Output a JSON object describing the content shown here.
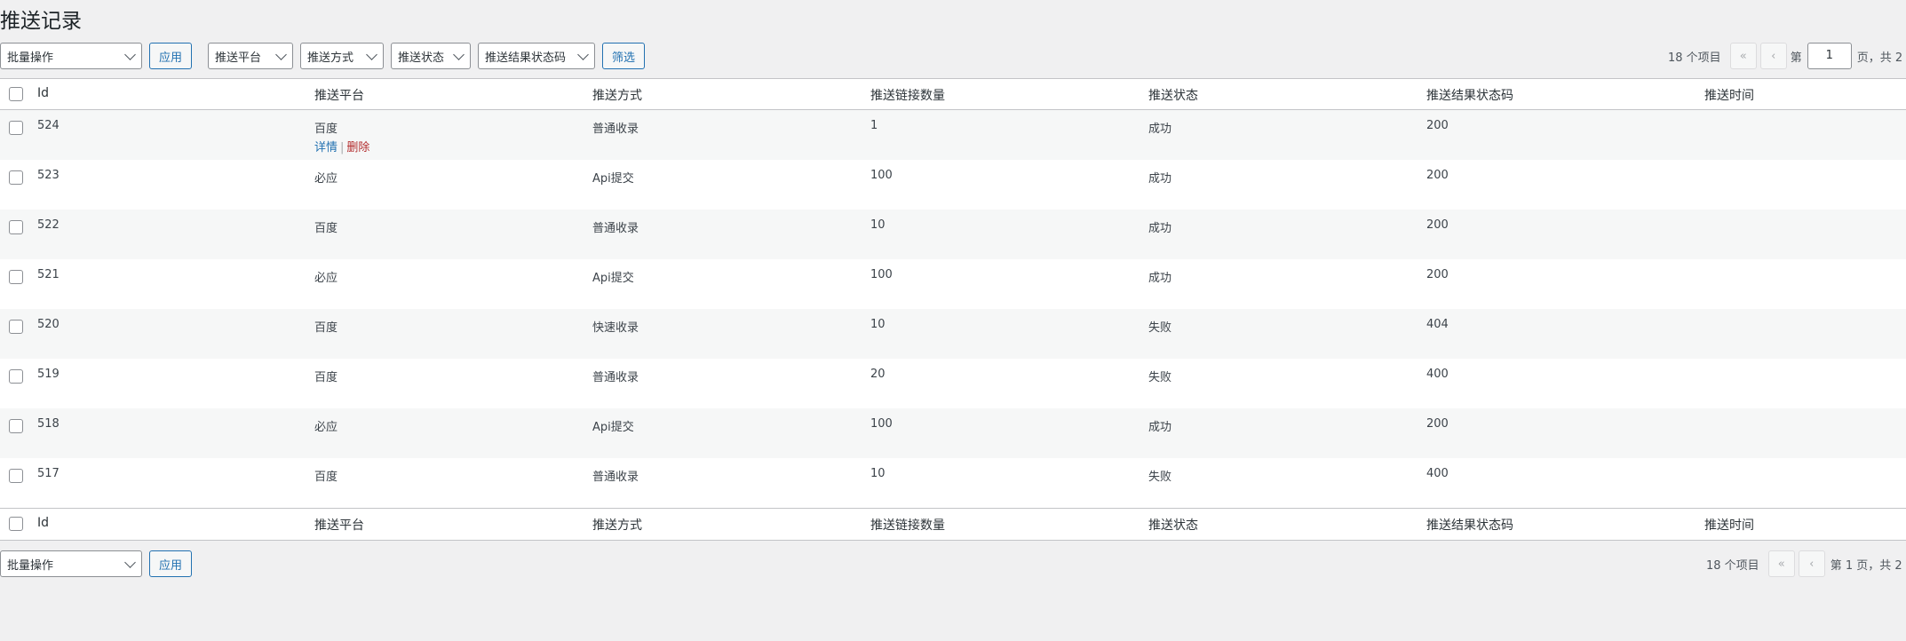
{
  "page_title": "推送记录",
  "top_bar": {
    "bulk_action": "批量操作",
    "apply": "应用",
    "filter_platform": "推送平台",
    "filter_method": "推送方式",
    "filter_status": "推送状态",
    "filter_result_code": "推送结果状态码",
    "filter_button": "筛选"
  },
  "pagination_top": {
    "count": "18 个项目",
    "first": "«",
    "prev": "‹",
    "prefix": "第",
    "current_page": "1",
    "suffix": "页，共 2 页"
  },
  "columns": [
    "Id",
    "推送平台",
    "推送方式",
    "推送链接数量",
    "推送状态",
    "推送结果状态码",
    "推送时间"
  ],
  "rows": [
    {
      "id": "524",
      "platform": "百度",
      "method": "普通收录",
      "count": "1",
      "status": "成功",
      "code": "200",
      "time": ""
    },
    {
      "id": "523",
      "platform": "必应",
      "method": "Api提交",
      "count": "100",
      "status": "成功",
      "code": "200",
      "time": ""
    },
    {
      "id": "522",
      "platform": "百度",
      "method": "普通收录",
      "count": "10",
      "status": "成功",
      "code": "200",
      "time": ""
    },
    {
      "id": "521",
      "platform": "必应",
      "method": "Api提交",
      "count": "100",
      "status": "成功",
      "code": "200",
      "time": ""
    },
    {
      "id": "520",
      "platform": "百度",
      "method": "快速收录",
      "count": "10",
      "status": "失败",
      "code": "404",
      "time": ""
    },
    {
      "id": "519",
      "platform": "百度",
      "method": "普通收录",
      "count": "20",
      "status": "失败",
      "code": "400",
      "time": ""
    },
    {
      "id": "518",
      "platform": "必应",
      "method": "Api提交",
      "count": "100",
      "status": "成功",
      "code": "200",
      "time": ""
    },
    {
      "id": "517",
      "platform": "百度",
      "method": "普通收录",
      "count": "10",
      "status": "失败",
      "code": "400",
      "time": ""
    }
  ],
  "row_actions": {
    "detail": "详情",
    "separator": "|",
    "delete": "删除"
  },
  "bottom_bar": {
    "bulk_action": "批量操作",
    "apply": "应用"
  },
  "pagination_bottom": {
    "count": "18 个项目",
    "first": "«",
    "prev": "‹",
    "page_text": "第 1 页，共 2 页"
  }
}
